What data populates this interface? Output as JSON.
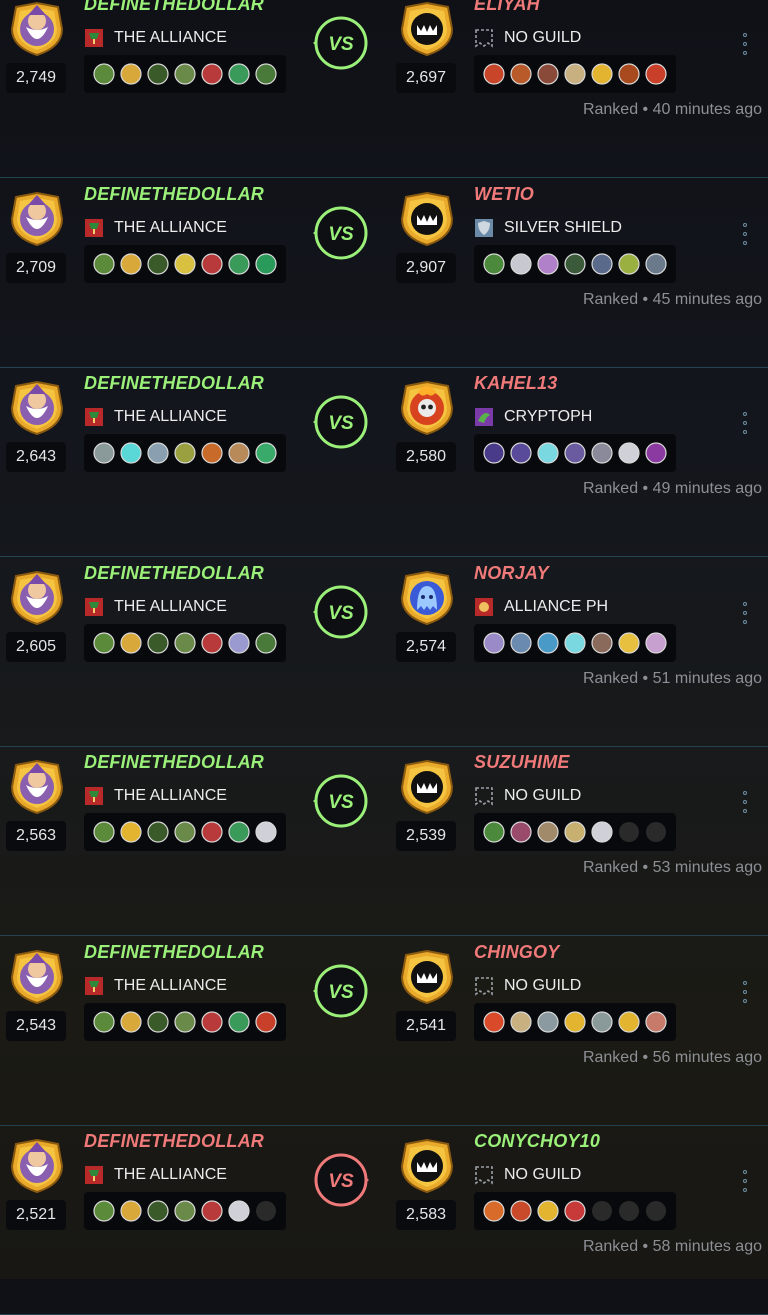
{
  "colors": {
    "win": "#9bf079",
    "lose": "#f07a7a",
    "accent_line": "#22434f"
  },
  "icons": {
    "menu": "kebab-menu-icon",
    "vs": "vs-badge-icon",
    "guild_none": "no-guild-icon"
  },
  "battles": [
    {
      "winner": "left",
      "player": {
        "name": "DEFINETHEDOLLAR",
        "rating": "2,749",
        "guild": "THE ALLIANCE",
        "guild_icon": "alliance-guild-icon",
        "avatar": "wizard-avatar",
        "monsters": [
          "#5a8a3a",
          "#d8a93a",
          "#3b5a2a",
          "#6a8a4a",
          "#b83a3a",
          "#3a9a5a",
          "#4a7a3a"
        ]
      },
      "opponent": {
        "name": "ELIYAH",
        "rating": "2,697",
        "guild": "NO GUILD",
        "guild_icon": "no-guild-icon",
        "avatar": "monster-avatar",
        "monsters": [
          "#c8452a",
          "#b85a2a",
          "#8a4a3a",
          "#c8b080",
          "#e2b430",
          "#a84a1e",
          "#c8402a"
        ]
      },
      "meta": "Ranked • 40 minutes ago"
    },
    {
      "winner": "left",
      "player": {
        "name": "DEFINETHEDOLLAR",
        "rating": "2,709",
        "guild": "THE ALLIANCE",
        "guild_icon": "alliance-guild-icon",
        "avatar": "wizard-avatar",
        "monsters": [
          "#5a8a3a",
          "#d8a93a",
          "#3b5a2a",
          "#d8c040",
          "#b83a3a",
          "#3a9a5a",
          "#2a9a5a"
        ]
      },
      "opponent": {
        "name": "WETIO",
        "rating": "2,907",
        "guild": "SILVER SHIELD",
        "guild_icon": "silver-shield-icon",
        "avatar": "monster-avatar",
        "monsters": [
          "#4a8a3a",
          "#c8c8d0",
          "#b080c8",
          "#3a5a3a",
          "#5a6a8a",
          "#9ab040",
          "#6a7a8a"
        ]
      },
      "meta": "Ranked • 45 minutes ago"
    },
    {
      "winner": "left",
      "player": {
        "name": "DEFINETHEDOLLAR",
        "rating": "2,643",
        "guild": "THE ALLIANCE",
        "guild_icon": "alliance-guild-icon",
        "avatar": "wizard-avatar",
        "monsters": [
          "#8a9a9a",
          "#5ad8d8",
          "#8aa0b0",
          "#9aa040",
          "#c86a2a",
          "#b88a5a",
          "#3aaa6a"
        ]
      },
      "opponent": {
        "name": "KAHEL13",
        "rating": "2,580",
        "guild": "CRYPTOPH",
        "guild_icon": "cryptoph-guild-icon",
        "avatar": "fire-skull-avatar",
        "monsters": [
          "#4a3a8a",
          "#5a4a9a",
          "#7ad8e0",
          "#6a5aa0",
          "#8a8a9a",
          "#d0d0d8",
          "#8a3aa0"
        ]
      },
      "meta": "Ranked • 49 minutes ago"
    },
    {
      "winner": "left",
      "player": {
        "name": "DEFINETHEDOLLAR",
        "rating": "2,605",
        "guild": "THE ALLIANCE",
        "guild_icon": "alliance-guild-icon",
        "avatar": "wizard-avatar",
        "monsters": [
          "#5a8a3a",
          "#d8a93a",
          "#3b5a2a",
          "#6a8a4a",
          "#b83a3a",
          "#9a9ad0",
          "#4a7a3a"
        ]
      },
      "opponent": {
        "name": "NORJAY",
        "rating": "2,574",
        "guild": "ALLIANCE PH",
        "guild_icon": "alliance-ph-guild-icon",
        "avatar": "ghost-avatar",
        "monsters": [
          "#9a8ac8",
          "#6a8ab0",
          "#4a9ac8",
          "#7ad8e0",
          "#8a6a5a",
          "#e8c040",
          "#c8a0d0"
        ]
      },
      "meta": "Ranked • 51 minutes ago"
    },
    {
      "winner": "left",
      "player": {
        "name": "DEFINETHEDOLLAR",
        "rating": "2,563",
        "guild": "THE ALLIANCE",
        "guild_icon": "alliance-guild-icon",
        "avatar": "wizard-avatar",
        "monsters": [
          "#5a8a3a",
          "#e2b430",
          "#3b5a2a",
          "#6a8a4a",
          "#b83a3a",
          "#3a9a5a",
          "#d0d0d8"
        ]
      },
      "opponent": {
        "name": "SUZUHIME",
        "rating": "2,539",
        "guild": "NO GUILD",
        "guild_icon": "no-guild-icon",
        "avatar": "monster-avatar",
        "monsters": [
          "#4a8a3a",
          "#9a4a6a",
          "#a08a6a",
          "#c8b070",
          "#d0d0d8",
          "#2a2a2a",
          "#2a2a2a"
        ]
      },
      "meta": "Ranked • 53 minutes ago"
    },
    {
      "winner": "left",
      "player": {
        "name": "DEFINETHEDOLLAR",
        "rating": "2,543",
        "guild": "THE ALLIANCE",
        "guild_icon": "alliance-guild-icon",
        "avatar": "wizard-avatar",
        "monsters": [
          "#5a8a3a",
          "#d8a93a",
          "#3b5a2a",
          "#6a8a4a",
          "#b83a3a",
          "#3a9a5a",
          "#c8402a"
        ]
      },
      "opponent": {
        "name": "CHINGOY",
        "rating": "2,541",
        "guild": "NO GUILD",
        "guild_icon": "no-guild-icon",
        "avatar": "monster-avatar",
        "monsters": [
          "#d84a2a",
          "#c8b080",
          "#8a9aa0",
          "#e2b430",
          "#8a9a9a",
          "#e2b430",
          "#c87a6a"
        ]
      },
      "meta": "Ranked • 56 minutes ago"
    },
    {
      "winner": "right",
      "player": {
        "name": "DEFINETHEDOLLAR",
        "rating": "2,521",
        "guild": "THE ALLIANCE",
        "guild_icon": "alliance-guild-icon",
        "avatar": "wizard-avatar",
        "monsters": [
          "#5a8a3a",
          "#d8a93a",
          "#3b5a2a",
          "#6a8a4a",
          "#b83a3a",
          "#d0d0d8",
          "#2a2a2a"
        ]
      },
      "opponent": {
        "name": "CONYCHOY10",
        "rating": "2,583",
        "guild": "NO GUILD",
        "guild_icon": "no-guild-icon",
        "avatar": "monster-avatar",
        "monsters": [
          "#d86a2a",
          "#c84a2a",
          "#e2b430",
          "#c83a3a",
          "#2a2a2a",
          "#2a2a2a",
          "#2a2a2a"
        ]
      },
      "meta": "Ranked • 58 minutes ago"
    }
  ]
}
